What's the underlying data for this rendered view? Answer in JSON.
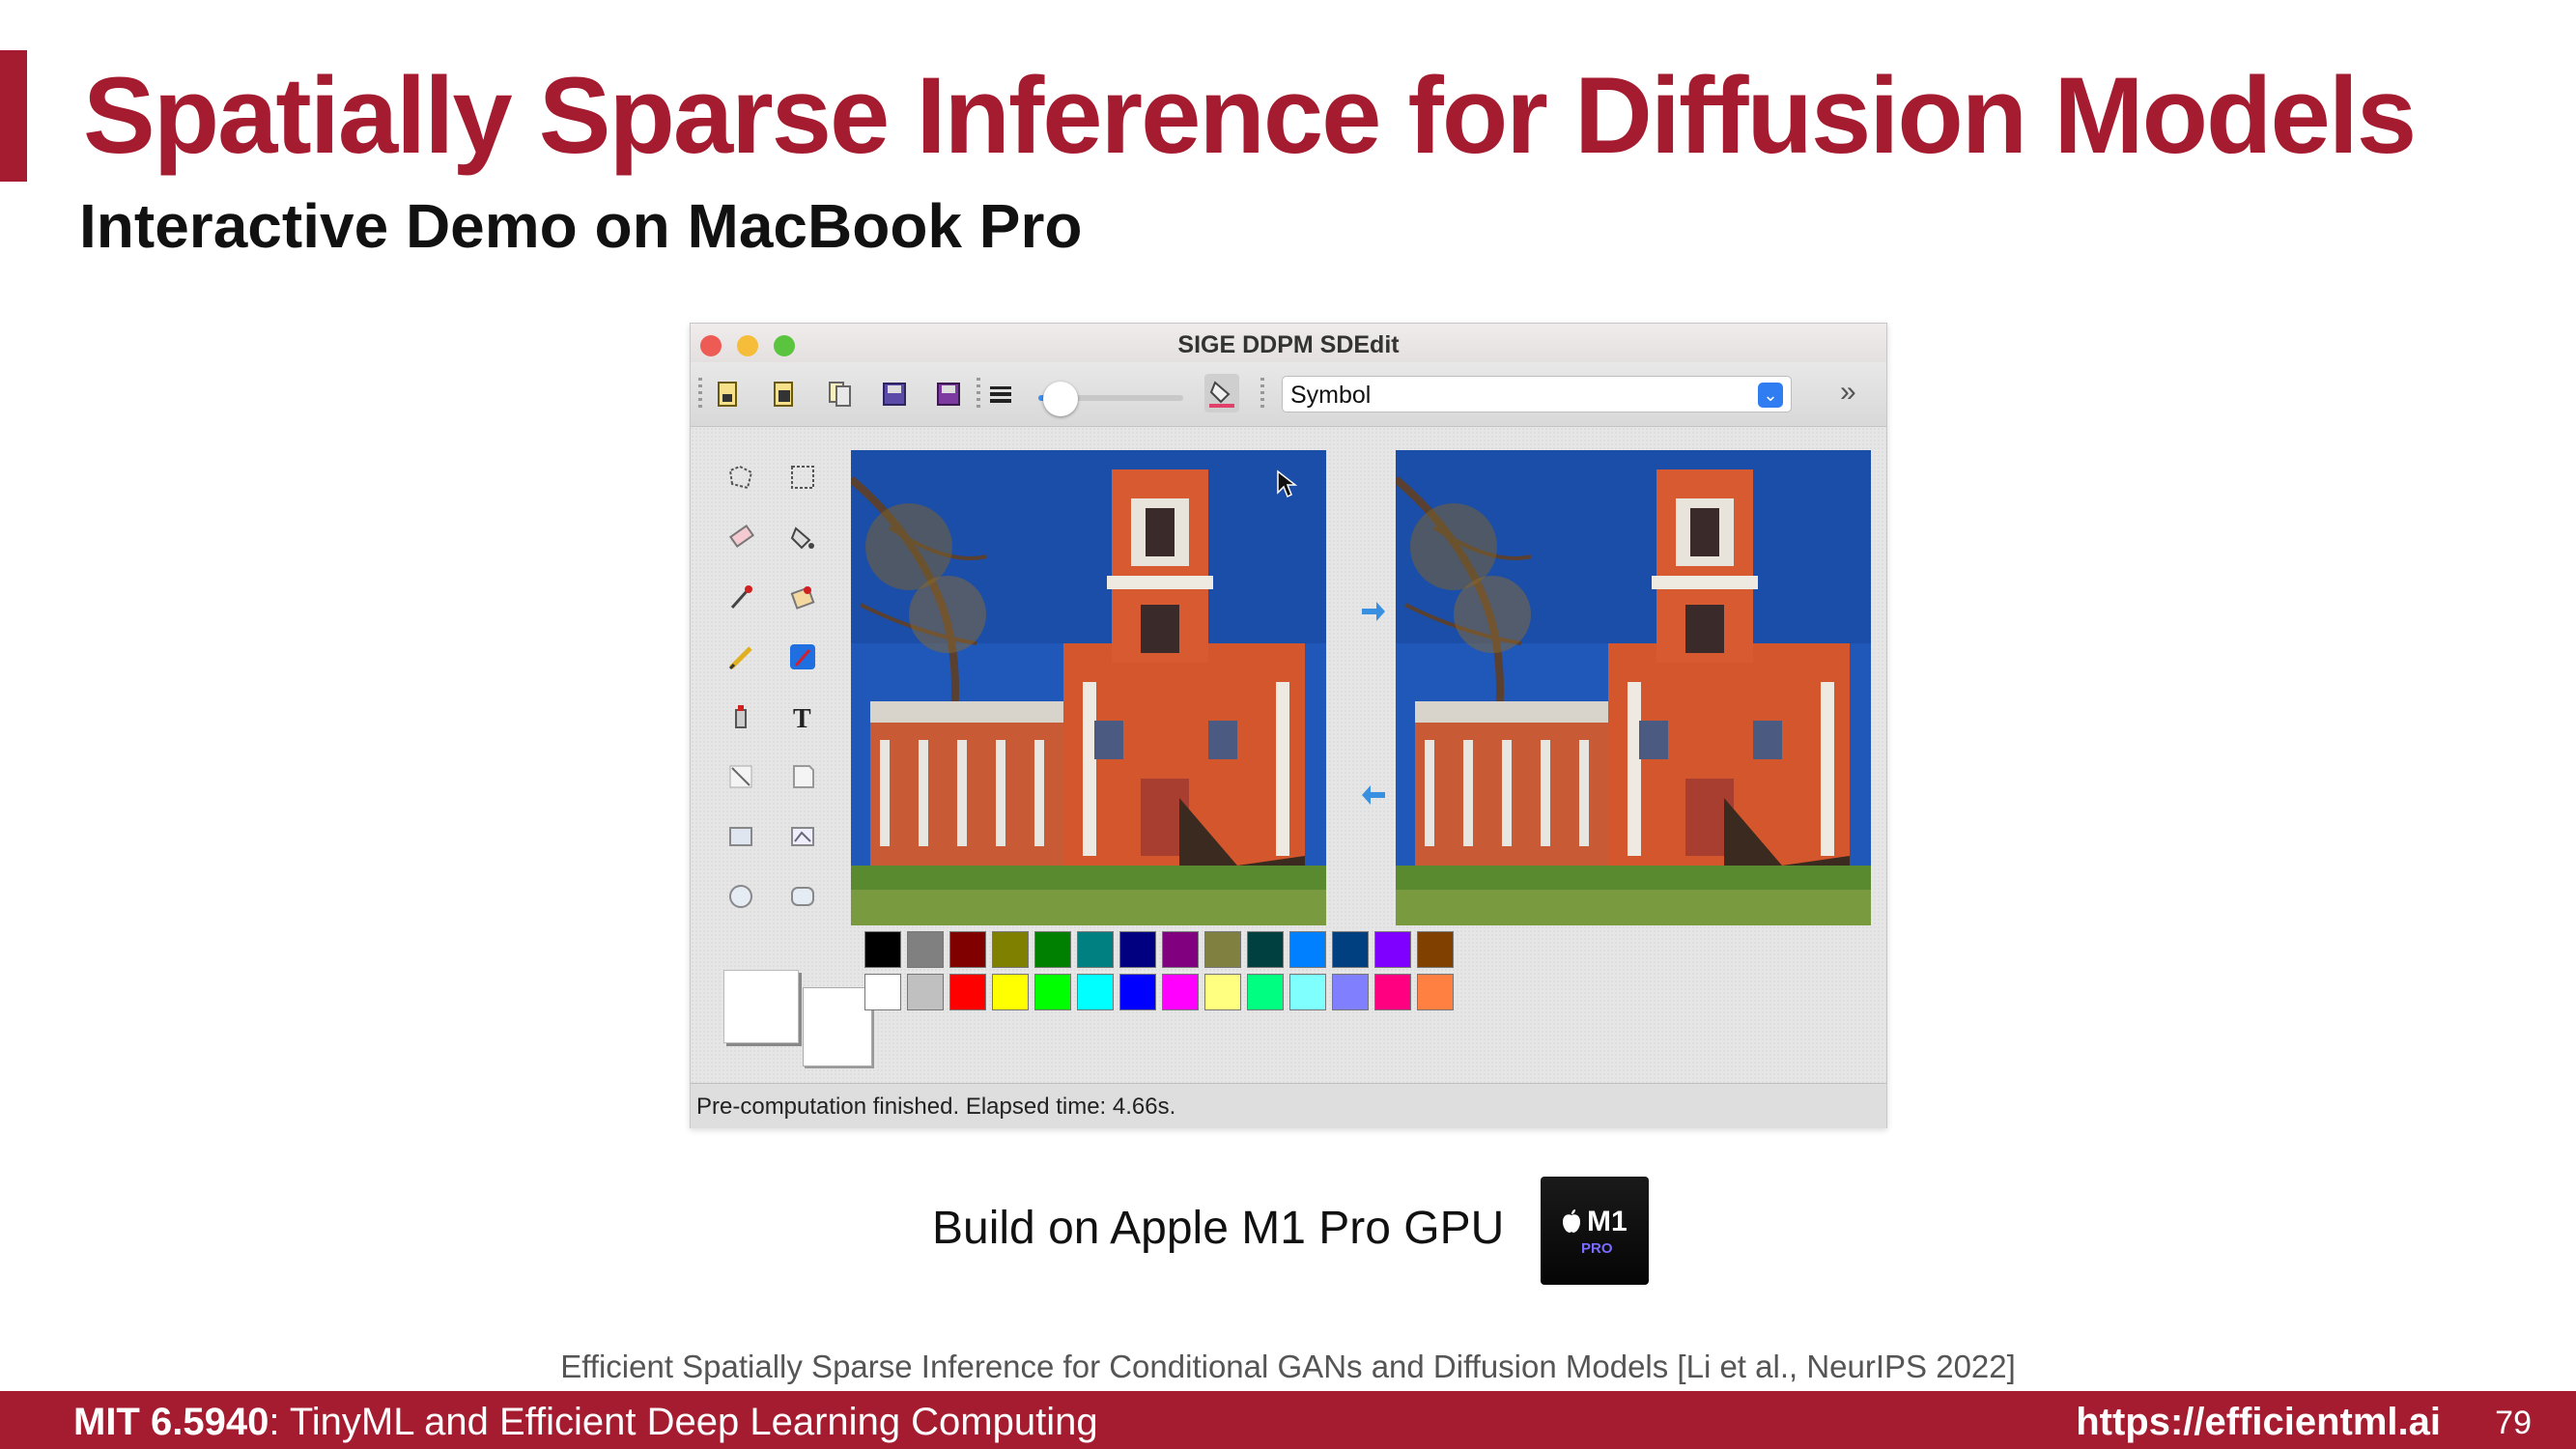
{
  "slide": {
    "title": "Spatially Sparse Inference for Diffusion Models",
    "subtitle": "Interactive Demo on MacBook Pro"
  },
  "app": {
    "window_title": "SIGE DDPM SDEdit",
    "toolbar": {
      "buttons": [
        "new-file-icon",
        "open-file-icon",
        "copy-icon",
        "save-icon",
        "save-as-icon",
        "line-width-icon",
        "fill-color-icon"
      ],
      "brush_size_level": 0.15,
      "symbol_select": "Symbol"
    },
    "tools": [
      "free-select-icon",
      "rect-select-icon",
      "eraser-icon",
      "fill-bucket-icon",
      "color-picker-icon",
      "zoom-icon",
      "pencil-icon",
      "brush-icon",
      "airbrush-icon",
      "text-icon",
      "line-icon",
      "curve-icon",
      "rectangle-icon",
      "polygon-icon",
      "ellipse-icon",
      "rounded-rect-icon"
    ],
    "palette": {
      "top": [
        "#000000",
        "#808080",
        "#800000",
        "#808000",
        "#008000",
        "#008080",
        "#000080",
        "#800080",
        "#808040",
        "#004040",
        "#0080ff",
        "#004080",
        "#8000ff",
        "#804000"
      ],
      "bottom": [
        "#ffffff",
        "#c0c0c0",
        "#ff0000",
        "#ffff00",
        "#00ff00",
        "#00ffff",
        "#0000ff",
        "#ff00ff",
        "#ffff80",
        "#00ff80",
        "#80ffff",
        "#8080ff",
        "#ff0080",
        "#ff8040"
      ]
    },
    "status": "Pre-computation finished. Elapsed time: 4.66s."
  },
  "chip_caption": "Build on Apple M1 Pro GPU",
  "chip": {
    "model": "M1",
    "tier": "PRO"
  },
  "citation": "Efficient Spatially Sparse Inference for Conditional GANs and Diffusion Models [Li et al., NeurIPS 2022]",
  "footer": {
    "course_code": "MIT 6.5940",
    "course_name": ": TinyML and Efficient Deep Learning Computing",
    "url": "https://efficientml.ai",
    "page": "79"
  },
  "colors": {
    "accent": "#a51c30"
  }
}
